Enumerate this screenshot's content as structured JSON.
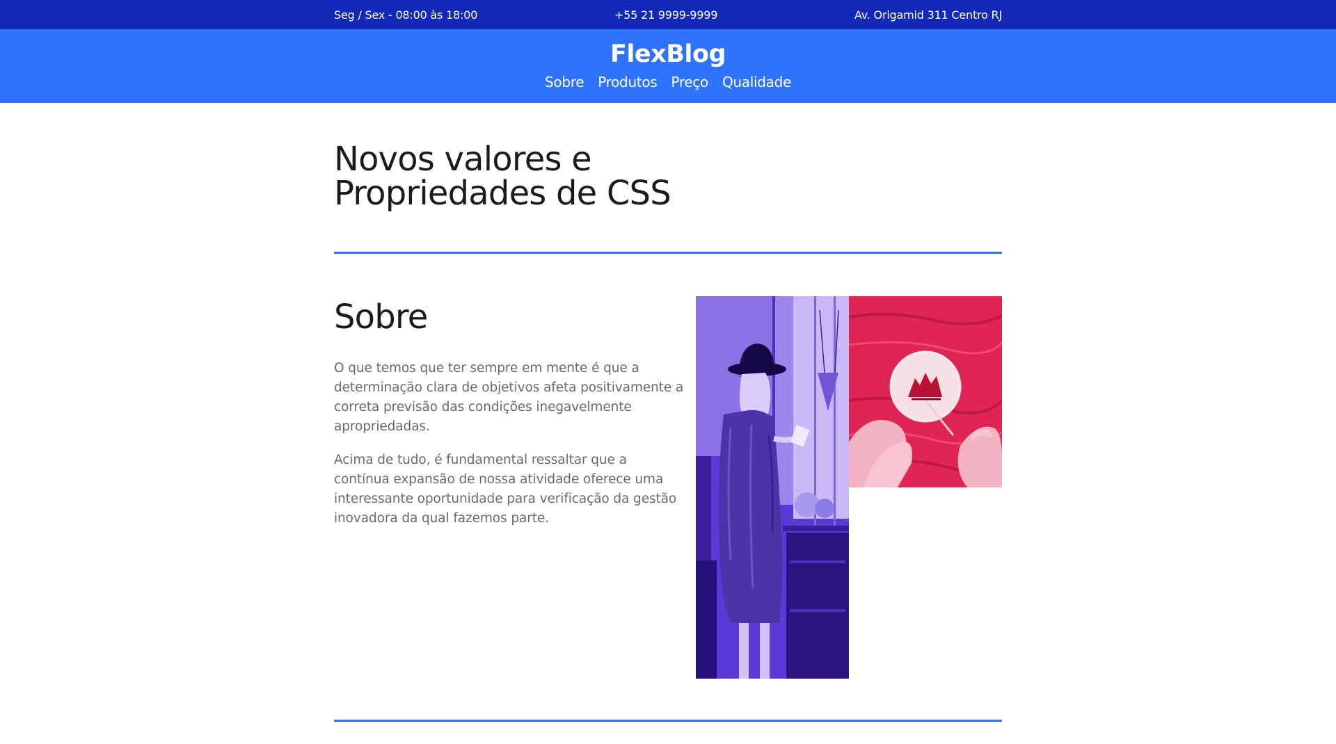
{
  "topbar": {
    "hours": "Seg / Sex - 08:00 às 18:00",
    "phone": "+55 21 9999-9999",
    "address": "Av. Origamid 311 Centro RJ"
  },
  "header": {
    "logo": "FlexBlog",
    "nav": [
      "Sobre",
      "Produtos",
      "Preço",
      "Qualidade"
    ]
  },
  "main": {
    "title_line1": "Novos valores e",
    "title_line2": "Propriedades de CSS"
  },
  "about": {
    "title": "Sobre",
    "paragraph1": "O que temos que ter sempre em mente é que a determinação clara de objetivos afeta positivamente a correta previsão das condições inegavelmente apropriedadas.",
    "paragraph2": "Acima de tudo, é fundamental ressaltar que a contínua expansão de nossa atividade oferece uma interessante oportunidade para verificação da gestão inovadora da qual fazemos parte."
  },
  "colors": {
    "topbar": "#1229b8",
    "header": "#2e72fd",
    "divider": "#2e72fd",
    "image1_tint": "#5b3bd8",
    "image2_tint": "#e32656"
  }
}
